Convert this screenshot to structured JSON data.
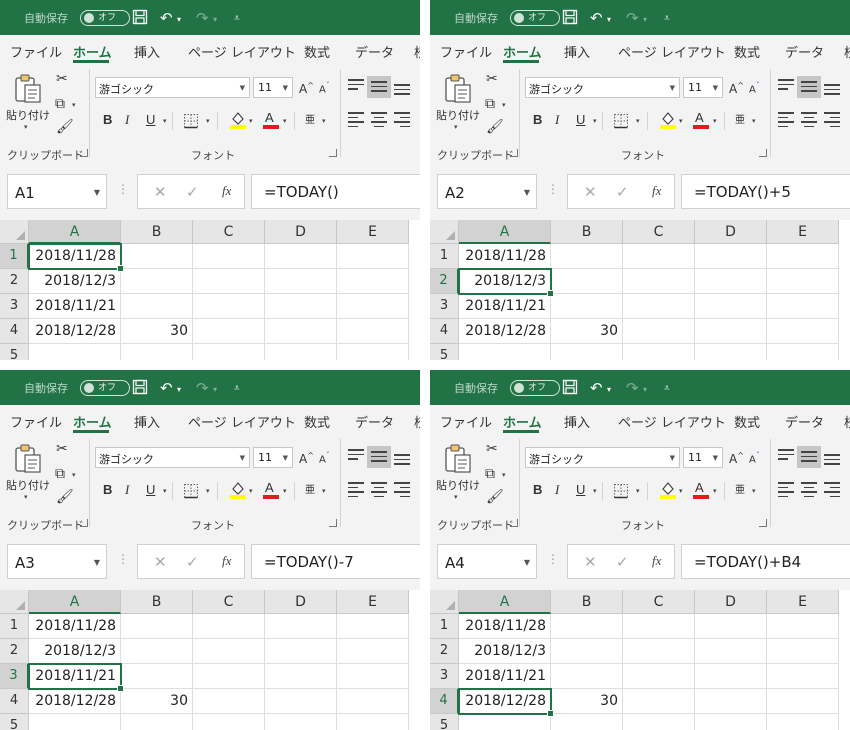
{
  "chrome": {
    "autosave_label": "自動保存",
    "autosave_state": "オフ",
    "tabs": [
      "ファイル",
      "ホーム",
      "挿入",
      "ページ レイアウト",
      "数式",
      "データ",
      "校"
    ],
    "clipboard_paste": "貼り付け",
    "clipboard_group": "クリップボード",
    "font_name": "游ゴシック",
    "font_size": "11",
    "font_group": "フォント",
    "bold": "B",
    "italic": "I",
    "underline": "U",
    "font_grow": "A",
    "font_shrink": "A",
    "phonetic": "亜",
    "fx": "fx"
  },
  "columns": [
    "A",
    "B",
    "C",
    "D",
    "E"
  ],
  "rows": [
    {
      "num": "1",
      "a": "2018/11/28",
      "b": ""
    },
    {
      "num": "2",
      "a": "2018/12/3",
      "b": ""
    },
    {
      "num": "3",
      "a": "2018/11/21",
      "b": ""
    },
    {
      "num": "4",
      "a": "2018/12/28",
      "b": "30"
    },
    {
      "num": "5",
      "a": "",
      "b": ""
    }
  ],
  "panels": [
    {
      "name_box": "A1",
      "formula": "=TODAY()",
      "selected_row": 1
    },
    {
      "name_box": "A2",
      "formula": "=TODAY()+5",
      "selected_row": 2
    },
    {
      "name_box": "A3",
      "formula": "=TODAY()-7",
      "selected_row": 3
    },
    {
      "name_box": "A4",
      "formula": "=TODAY()+B4",
      "selected_row": 4
    }
  ],
  "colors": {
    "excel_green": "#217346"
  }
}
